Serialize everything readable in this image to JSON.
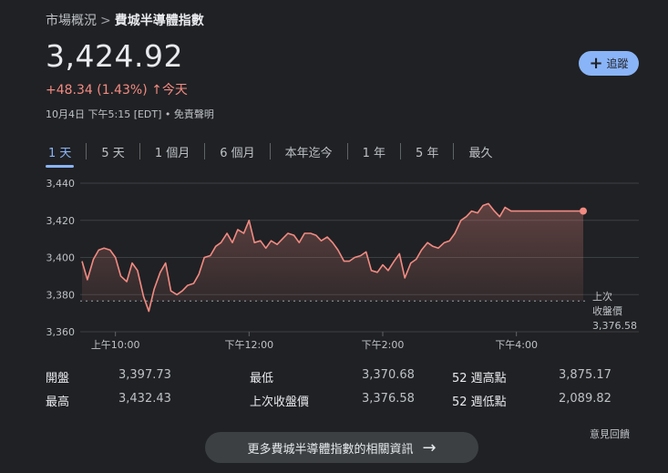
{
  "breadcrumb": {
    "parent": "市場概況",
    "separator": ">",
    "current": "費城半導體指數"
  },
  "quote": {
    "price": "3,424.92",
    "change": "+48.34 (1.43%)",
    "arrow": "↑",
    "period": "今天",
    "meta": "10月4日 下午5:15 [EDT] • 免責聲明"
  },
  "follow_label": "追蹤",
  "tabs": [
    "1 天",
    "5 天",
    "1 個月",
    "6 個月",
    "本年迄今",
    "1 年",
    "5 年",
    "最久"
  ],
  "active_tab": 0,
  "chart_data": {
    "type": "line",
    "y_ticks": [
      "3,440",
      "3,420",
      "3,400",
      "3,380",
      "3,360"
    ],
    "ylim": [
      3360,
      3440
    ],
    "x_ticks": [
      "上午10:00",
      "下午12:00",
      "下午2:00",
      "下午4:00"
    ],
    "x_tick_times": [
      10,
      12,
      14,
      16
    ],
    "xlim": [
      9.5,
      17.0
    ],
    "previous_close": 3376.58,
    "previous_close_label": [
      "上次",
      "收盤價",
      "3,376.58"
    ],
    "line_color": "#f28b82",
    "series": [
      {
        "x": [
          9.5,
          9.58,
          9.67,
          9.75,
          9.83,
          9.92,
          10.0,
          10.08,
          10.17,
          10.25,
          10.33,
          10.42,
          10.5,
          10.58,
          10.67,
          10.75,
          10.83,
          10.92,
          11.0,
          11.08,
          11.17,
          11.25,
          11.33,
          11.42,
          11.5,
          11.58,
          11.67,
          11.75,
          11.83,
          11.92,
          12.0,
          12.08,
          12.17,
          12.25,
          12.33,
          12.42,
          12.5,
          12.58,
          12.67,
          12.75,
          12.83,
          12.92,
          13.0,
          13.08,
          13.17,
          13.25,
          13.33,
          13.42,
          13.5,
          13.58,
          13.67,
          13.75,
          13.83,
          13.92,
          14.0,
          14.08,
          14.17,
          14.25,
          14.33,
          14.42,
          14.5,
          14.58,
          14.67,
          14.75,
          14.83,
          14.92,
          15.0,
          15.08,
          15.17,
          15.25,
          15.33,
          15.42,
          15.5,
          15.58,
          15.67,
          15.75,
          15.83,
          15.92,
          16.0,
          16.08,
          16.17,
          16.25,
          16.5,
          16.75,
          17.0
        ],
        "y": [
          3398,
          3388,
          3399,
          3404,
          3405,
          3404,
          3400,
          3390,
          3387,
          3397,
          3393,
          3379,
          3371,
          3383,
          3392,
          3397,
          3382,
          3380,
          3382,
          3385,
          3386,
          3391,
          3400,
          3401,
          3406,
          3408,
          3413,
          3408,
          3415,
          3413,
          3420,
          3408,
          3409,
          3405,
          3409,
          3407,
          3410,
          3413,
          3412,
          3408,
          3413,
          3413,
          3412,
          3409,
          3411,
          3408,
          3404,
          3398,
          3398,
          3400,
          3401,
          3403,
          3393,
          3392,
          3396,
          3393,
          3398,
          3402,
          3389,
          3397,
          3399,
          3404,
          3408,
          3406,
          3405,
          3408,
          3409,
          3413,
          3420,
          3422,
          3425,
          3424,
          3428,
          3429,
          3425,
          3422,
          3427,
          3425,
          3425,
          3425,
          3425,
          3425,
          3425,
          3425,
          3425
        ]
      }
    ],
    "last_point": [
      17.0,
      3425
    ]
  },
  "stats": [
    [
      {
        "label": "開盤",
        "value": "3,397.73"
      },
      {
        "label": "最低",
        "value": "3,370.68"
      },
      {
        "label": "52 週高點",
        "value": "3,875.17"
      }
    ],
    [
      {
        "label": "最高",
        "value": "3,432.43"
      },
      {
        "label": "上次收盤價",
        "value": "3,376.58"
      },
      {
        "label": "52 週低點",
        "value": "2,089.82"
      }
    ]
  ],
  "feedback": "意見回饋",
  "more_button": {
    "label": "更多費城半導體指數的相關資訊",
    "arrow": "→"
  }
}
